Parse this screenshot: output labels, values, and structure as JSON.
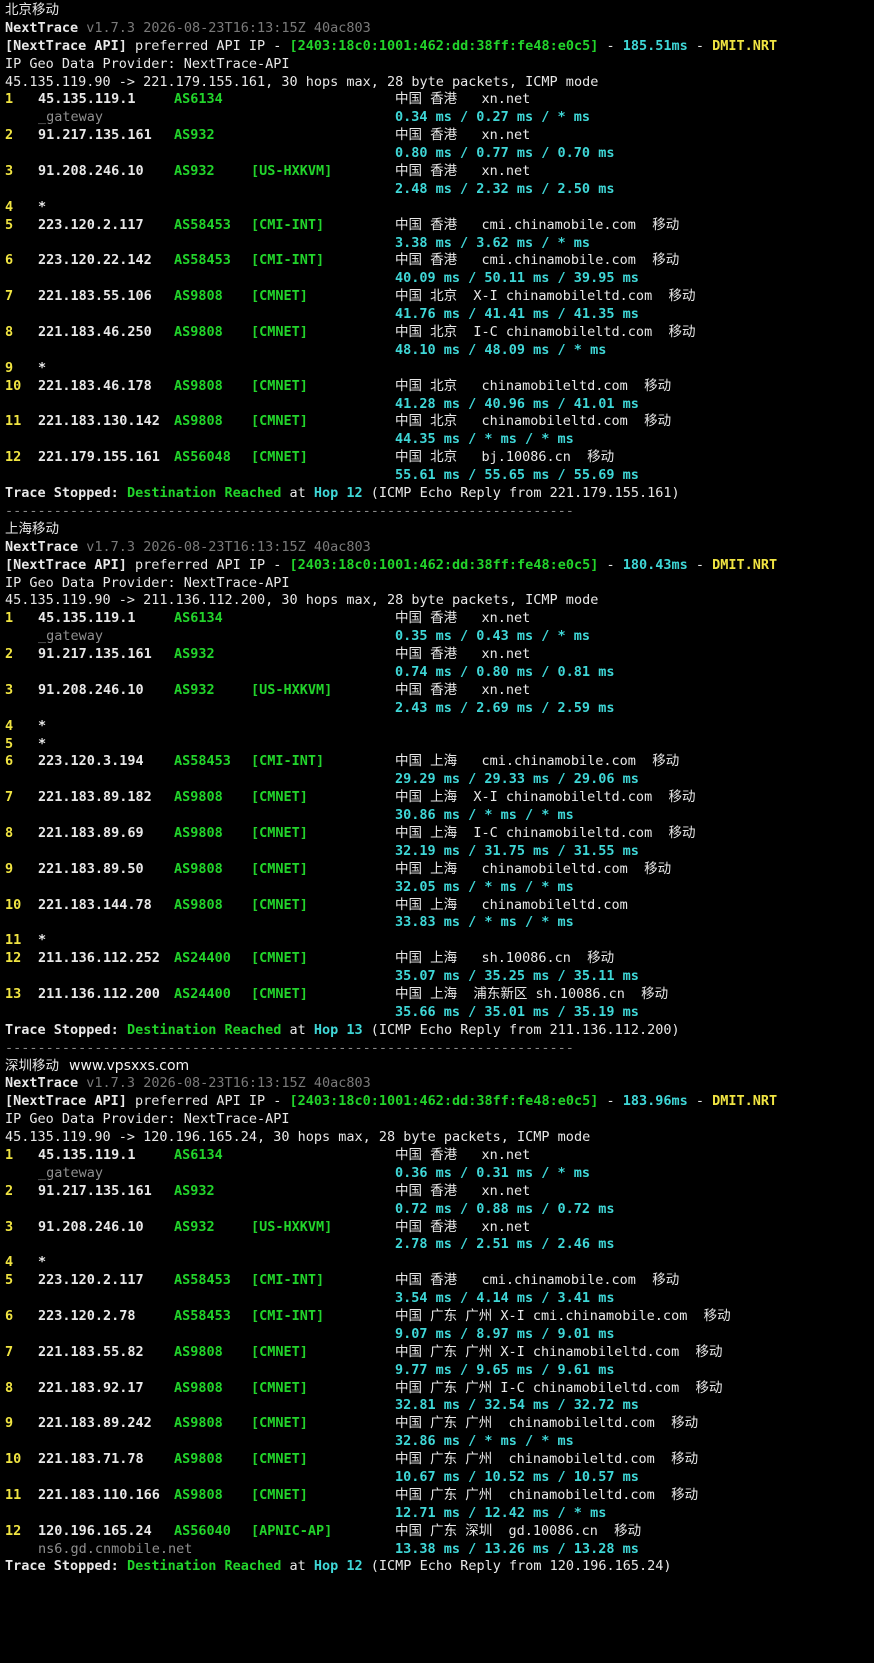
{
  "watermark": "www.vpsxxs.com",
  "sections": [
    {
      "title": "北京移动",
      "nexttrace": "NextTrace",
      "version": "v1.7.3 2026-08-23T16:13:15Z 40ac803",
      "api_prefix": "[NextTrace API]",
      "api_mid": " preferred API IP - ",
      "api_ip": "[2403:18c0:1001:462:dd:38ff:fe48:e0c5]",
      "api_dash": " - ",
      "api_ms": "185.51ms",
      "api_node": "DMIT.NRT",
      "geo_provider": "IP Geo Data Provider: NextTrace-API",
      "route": "45.135.119.90 -> 221.179.155.161, 30 hops max, 28 byte packets, ICMP mode",
      "hops": [
        {
          "n": "1",
          "ip": "45.135.119.1",
          "as": "AS6134",
          "tag": "",
          "geo": "中国 香港   xn.net",
          "sub": "_gateway",
          "rtt": "0.34 ms / 0.27 ms / * ms"
        },
        {
          "n": "2",
          "ip": "91.217.135.161",
          "as": "AS932",
          "tag": "",
          "geo": "中国 香港   xn.net",
          "sub": "",
          "rtt": "0.80 ms / 0.77 ms / 0.70 ms"
        },
        {
          "n": "3",
          "ip": "91.208.246.10",
          "as": "AS932",
          "tag": "[US-HXKVM]",
          "geo": "中国 香港   xn.net",
          "sub": "",
          "rtt": "2.48 ms / 2.32 ms / 2.50 ms"
        },
        {
          "n": "4",
          "ip": "*",
          "as": "",
          "tag": "",
          "geo": "",
          "sub": "",
          "rtt": ""
        },
        {
          "n": "5",
          "ip": "223.120.2.117",
          "as": "AS58453",
          "tag": "[CMI-INT]",
          "geo": "中国 香港   cmi.chinamobile.com  移动",
          "sub": "",
          "rtt": "3.38 ms / 3.62 ms / * ms"
        },
        {
          "n": "6",
          "ip": "223.120.22.142",
          "as": "AS58453",
          "tag": "[CMI-INT]",
          "geo": "中国 香港   cmi.chinamobile.com  移动",
          "sub": "",
          "rtt": "40.09 ms / 50.11 ms / 39.95 ms"
        },
        {
          "n": "7",
          "ip": "221.183.55.106",
          "as": "AS9808",
          "tag": "[CMNET]",
          "geo": "中国 北京  X-I chinamobileltd.com  移动",
          "sub": "",
          "rtt": "41.76 ms / 41.41 ms / 41.35 ms"
        },
        {
          "n": "8",
          "ip": "221.183.46.250",
          "as": "AS9808",
          "tag": "[CMNET]",
          "geo": "中国 北京  I-C chinamobileltd.com  移动",
          "sub": "",
          "rtt": "48.10 ms / 48.09 ms / * ms"
        },
        {
          "n": "9",
          "ip": "*",
          "as": "",
          "tag": "",
          "geo": "",
          "sub": "",
          "rtt": ""
        },
        {
          "n": "10",
          "ip": "221.183.46.178",
          "as": "AS9808",
          "tag": "[CMNET]",
          "geo": "中国 北京   chinamobileltd.com  移动",
          "sub": "",
          "rtt": "41.28 ms / 40.96 ms / 41.01 ms"
        },
        {
          "n": "11",
          "ip": "221.183.130.142",
          "as": "AS9808",
          "tag": "[CMNET]",
          "geo": "中国 北京   chinamobileltd.com  移动",
          "sub": "",
          "rtt": "44.35 ms / * ms / * ms"
        },
        {
          "n": "12",
          "ip": "221.179.155.161",
          "as": "AS56048",
          "tag": "[CMNET]",
          "geo": "中国 北京   bj.10086.cn  移动",
          "sub": "",
          "rtt": "55.61 ms / 55.65 ms / 55.69 ms"
        }
      ],
      "stop_label": "Trace Stopped:",
      "stop_reached": "Destination Reached",
      "stop_at": " at ",
      "stop_hop": "Hop 12",
      "stop_tail": " (ICMP Echo Reply from 221.179.155.161)"
    },
    {
      "title": "上海移动",
      "nexttrace": "NextTrace",
      "version": "v1.7.3 2026-08-23T16:13:15Z 40ac803",
      "api_prefix": "[NextTrace API]",
      "api_mid": " preferred API IP - ",
      "api_ip": "[2403:18c0:1001:462:dd:38ff:fe48:e0c5]",
      "api_dash": " - ",
      "api_ms": "180.43ms",
      "api_node": "DMIT.NRT",
      "geo_provider": "IP Geo Data Provider: NextTrace-API",
      "route": "45.135.119.90 -> 211.136.112.200, 30 hops max, 28 byte packets, ICMP mode",
      "hops": [
        {
          "n": "1",
          "ip": "45.135.119.1",
          "as": "AS6134",
          "tag": "",
          "geo": "中国 香港   xn.net",
          "sub": "_gateway",
          "rtt": "0.35 ms / 0.43 ms / * ms"
        },
        {
          "n": "2",
          "ip": "91.217.135.161",
          "as": "AS932",
          "tag": "",
          "geo": "中国 香港   xn.net",
          "sub": "",
          "rtt": "0.74 ms / 0.80 ms / 0.81 ms"
        },
        {
          "n": "3",
          "ip": "91.208.246.10",
          "as": "AS932",
          "tag": "[US-HXKVM]",
          "geo": "中国 香港   xn.net",
          "sub": "",
          "rtt": "2.43 ms / 2.69 ms / 2.59 ms"
        },
        {
          "n": "4",
          "ip": "*",
          "as": "",
          "tag": "",
          "geo": "",
          "sub": "",
          "rtt": ""
        },
        {
          "n": "5",
          "ip": "*",
          "as": "",
          "tag": "",
          "geo": "",
          "sub": "",
          "rtt": ""
        },
        {
          "n": "6",
          "ip": "223.120.3.194",
          "as": "AS58453",
          "tag": "[CMI-INT]",
          "geo": "中国 上海   cmi.chinamobile.com  移动",
          "sub": "",
          "rtt": "29.29 ms / 29.33 ms / 29.06 ms"
        },
        {
          "n": "7",
          "ip": "221.183.89.182",
          "as": "AS9808",
          "tag": "[CMNET]",
          "geo": "中国 上海  X-I chinamobileltd.com  移动",
          "sub": "",
          "rtt": "30.86 ms / * ms / * ms"
        },
        {
          "n": "8",
          "ip": "221.183.89.69",
          "as": "AS9808",
          "tag": "[CMNET]",
          "geo": "中国 上海  I-C chinamobileltd.com  移动",
          "sub": "",
          "rtt": "32.19 ms / 31.75 ms / 31.55 ms"
        },
        {
          "n": "9",
          "ip": "221.183.89.50",
          "as": "AS9808",
          "tag": "[CMNET]",
          "geo": "中国 上海   chinamobileltd.com  移动",
          "sub": "",
          "rtt": "32.05 ms / * ms / * ms"
        },
        {
          "n": "10",
          "ip": "221.183.144.78",
          "as": "AS9808",
          "tag": "[CMNET]",
          "geo": "中国 上海   chinamobileltd.com",
          "sub": "",
          "rtt": "33.83 ms / * ms / * ms"
        },
        {
          "n": "11",
          "ip": "*",
          "as": "",
          "tag": "",
          "geo": "",
          "sub": "",
          "rtt": ""
        },
        {
          "n": "12",
          "ip": "211.136.112.252",
          "as": "AS24400",
          "tag": "[CMNET]",
          "geo": "中国 上海   sh.10086.cn  移动",
          "sub": "",
          "rtt": "35.07 ms / 35.25 ms / 35.11 ms"
        },
        {
          "n": "13",
          "ip": "211.136.112.200",
          "as": "AS24400",
          "tag": "[CMNET]",
          "geo": "中国 上海  浦东新区 sh.10086.cn  移动",
          "sub": "",
          "rtt": "35.66 ms / 35.01 ms / 35.19 ms"
        }
      ],
      "stop_label": "Trace Stopped:",
      "stop_reached": "Destination Reached",
      "stop_at": " at ",
      "stop_hop": "Hop 13",
      "stop_tail": " (ICMP Echo Reply from 211.136.112.200)"
    },
    {
      "title": "深圳移动",
      "nexttrace": "NextTrace",
      "version": "v1.7.3 2026-08-23T16:13:15Z 40ac803",
      "api_prefix": "[NextTrace API]",
      "api_mid": " preferred API IP - ",
      "api_ip": "[2403:18c0:1001:462:dd:38ff:fe48:e0c5]",
      "api_dash": " - ",
      "api_ms": "183.96ms",
      "api_node": "DMIT.NRT",
      "geo_provider": "IP Geo Data Provider: NextTrace-API",
      "route": "45.135.119.90 -> 120.196.165.24, 30 hops max, 28 byte packets, ICMP mode",
      "hops": [
        {
          "n": "1",
          "ip": "45.135.119.1",
          "as": "AS6134",
          "tag": "",
          "geo": "中国 香港   xn.net",
          "sub": "_gateway",
          "rtt": "0.36 ms / 0.31 ms / * ms"
        },
        {
          "n": "2",
          "ip": "91.217.135.161",
          "as": "AS932",
          "tag": "",
          "geo": "中国 香港   xn.net",
          "sub": "",
          "rtt": "0.72 ms / 0.88 ms / 0.72 ms"
        },
        {
          "n": "3",
          "ip": "91.208.246.10",
          "as": "AS932",
          "tag": "[US-HXKVM]",
          "geo": "中国 香港   xn.net",
          "sub": "",
          "rtt": "2.78 ms / 2.51 ms / 2.46 ms"
        },
        {
          "n": "4",
          "ip": "*",
          "as": "",
          "tag": "",
          "geo": "",
          "sub": "",
          "rtt": ""
        },
        {
          "n": "5",
          "ip": "223.120.2.117",
          "as": "AS58453",
          "tag": "[CMI-INT]",
          "geo": "中国 香港   cmi.chinamobile.com  移动",
          "sub": "",
          "rtt": "3.54 ms / 4.14 ms / 3.41 ms"
        },
        {
          "n": "6",
          "ip": "223.120.2.78",
          "as": "AS58453",
          "tag": "[CMI-INT]",
          "geo": "中国 广东 广州 X-I cmi.chinamobile.com  移动",
          "sub": "",
          "rtt": "9.07 ms / 8.97 ms / 9.01 ms"
        },
        {
          "n": "7",
          "ip": "221.183.55.82",
          "as": "AS9808",
          "tag": "[CMNET]",
          "geo": "中国 广东 广州 X-I chinamobileltd.com  移动",
          "sub": "",
          "rtt": "9.77 ms / 9.65 ms / 9.61 ms"
        },
        {
          "n": "8",
          "ip": "221.183.92.17",
          "as": "AS9808",
          "tag": "[CMNET]",
          "geo": "中国 广东 广州 I-C chinamobileltd.com  移动",
          "sub": "",
          "rtt": "32.81 ms / 32.54 ms / 32.72 ms"
        },
        {
          "n": "9",
          "ip": "221.183.89.242",
          "as": "AS9808",
          "tag": "[CMNET]",
          "geo": "中国 广东 广州  chinamobileltd.com  移动",
          "sub": "",
          "rtt": "32.86 ms / * ms / * ms"
        },
        {
          "n": "10",
          "ip": "221.183.71.78",
          "as": "AS9808",
          "tag": "[CMNET]",
          "geo": "中国 广东 广州  chinamobileltd.com  移动",
          "sub": "",
          "rtt": "10.67 ms / 10.52 ms / 10.57 ms"
        },
        {
          "n": "11",
          "ip": "221.183.110.166",
          "as": "AS9808",
          "tag": "[CMNET]",
          "geo": "中国 广东 广州  chinamobileltd.com  移动",
          "sub": "",
          "rtt": "12.71 ms / 12.42 ms / * ms"
        },
        {
          "n": "12",
          "ip": "120.196.165.24",
          "as": "AS56040",
          "tag": "[APNIC-AP]",
          "geo": "中国 广东 深圳  gd.10086.cn  移动",
          "sub": "ns6.gd.cnmobile.net",
          "rtt": "13.38 ms / 13.26 ms / 13.28 ms"
        }
      ],
      "stop_label": "Trace Stopped:",
      "stop_reached": "Destination Reached",
      "stop_at": " at ",
      "stop_hop": "Hop 12",
      "stop_tail": " (ICMP Echo Reply from 120.196.165.24)"
    }
  ],
  "separator": "----------------------------------------------------------------------",
  "colors": {
    "background": "#000000",
    "hop_number": "#f0e442",
    "asn": "#22d42b",
    "rtt": "#3fd7d7",
    "text": "#dcdcdc"
  }
}
